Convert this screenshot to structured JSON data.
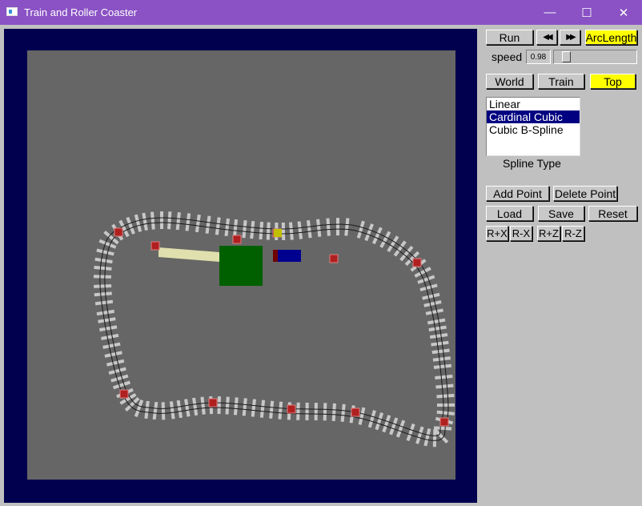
{
  "window": {
    "title": "Train and Roller Coaster",
    "minimize": "—",
    "maximize": "☐",
    "close": "✕"
  },
  "controls": {
    "run": "Run",
    "rewind": "◀◀",
    "forward": "▶▶",
    "arclength": "ArcLength",
    "speed_label": "speed",
    "speed_value": "0.98",
    "speed_slider_level": 0.1,
    "views": [
      "World",
      "Train",
      "Top"
    ],
    "selected_view": "Top",
    "spline_types": [
      "Linear",
      "Cardinal Cubic",
      "Cubic B-Spline"
    ],
    "selected_spline": "Cardinal Cubic",
    "spline_label": "Spline Type",
    "add_point": "Add Point",
    "delete_point": "Delete Point",
    "load": "Load",
    "save": "Save",
    "reset": "Reset",
    "rx_plus": "R+X",
    "rx_minus": "R-X",
    "rz_plus": "R+Z",
    "rz_minus": "R-Z"
  },
  "colors": {
    "title_bar": "#8a52c4",
    "highlight": "#ffff00",
    "viewport_border": "#00004f",
    "floor": "#666666",
    "train": "#000090",
    "control_point": "#b02020",
    "scenery_box": "#006000"
  }
}
